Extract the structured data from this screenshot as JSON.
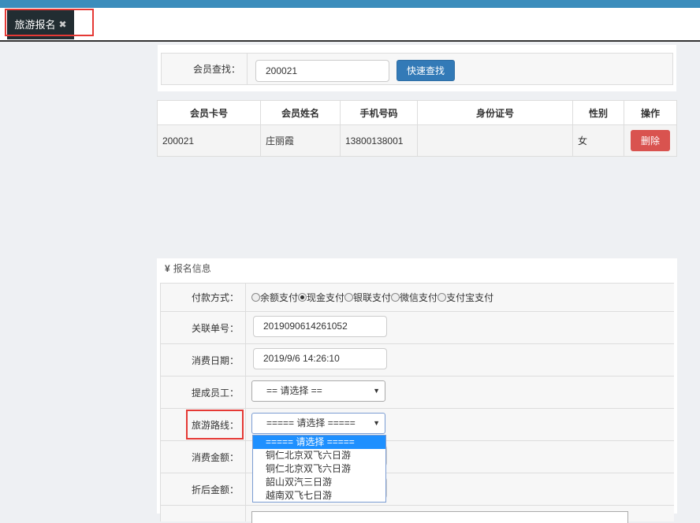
{
  "tab": {
    "label": "旅游报名"
  },
  "search": {
    "label": "会员查找：",
    "value": "200021",
    "button": "快速查找"
  },
  "member_table": {
    "headers": [
      "会员卡号",
      "会员姓名",
      "手机号码",
      "身份证号",
      "性别",
      "操作"
    ],
    "row": {
      "card": "200021",
      "name": "庄丽霞",
      "phone": "13800138001",
      "id_no": "",
      "gender": "女",
      "action": "删除"
    }
  },
  "info": {
    "title": "报名信息",
    "payment": {
      "label": "付款方式：",
      "options": [
        "余额支付",
        "现金支付",
        "银联支付",
        "微信支付",
        "支付宝支付"
      ],
      "selected": "现金支付"
    },
    "order_no": {
      "label": "关联单号：",
      "value": "2019090614261052"
    },
    "date": {
      "label": "消费日期：",
      "value": "2019/9/6 14:26:10"
    },
    "staff": {
      "label": "提成员工：",
      "value": "== 请选择 =="
    },
    "route": {
      "label": "旅游路线：",
      "value": "===== 请选择 ====="
    },
    "amount": {
      "label": "消费金额："
    },
    "discount": {
      "label": "折后金额："
    },
    "route_options": [
      "===== 请选择 =====",
      "铜仁北京双飞六日游",
      "铜仁北京双飞六日游",
      "韶山双汽三日游",
      "越南双飞七日游"
    ]
  }
}
